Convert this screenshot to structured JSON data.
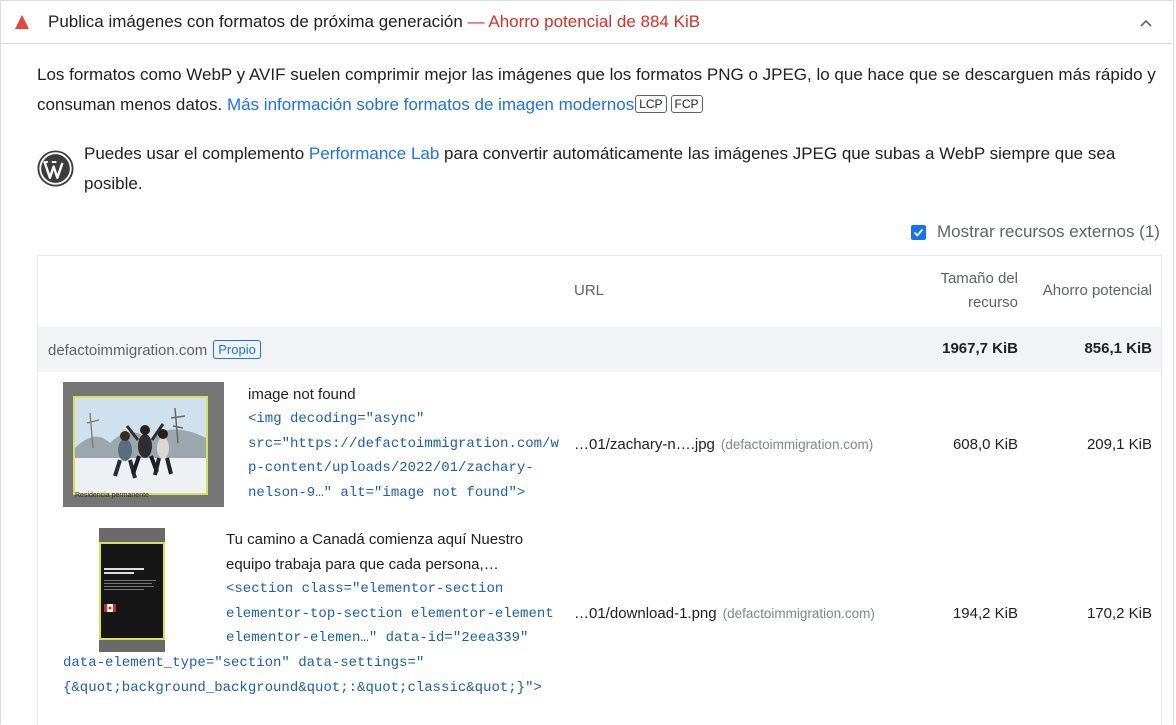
{
  "audit": {
    "title": "Publica imágenes con formatos de próxima generación",
    "savings_text": "— Ahorro potencial de 884 KiB"
  },
  "description": {
    "text": "Los formatos como WebP y AVIF suelen comprimir mejor las imágenes que los formatos PNG o JPEG, lo que hace que se descarguen más rápido y consuman menos datos. ",
    "link": "Más información sobre formatos de imagen modernos",
    "badges": [
      "LCP",
      "FCP"
    ]
  },
  "wordpress_hint": {
    "before": "Puedes usar el complemento ",
    "link": "Performance Lab",
    "after": " para convertir automáticamente las imágenes JPEG que subas a WebP siempre que sea posible."
  },
  "external_toggle": {
    "label": "Mostrar recursos externos (1)",
    "checked": true
  },
  "table": {
    "headers": {
      "url": "URL",
      "size": "Tamaño del recurso",
      "savings": "Ahorro potencial"
    },
    "group": {
      "name": "defactoimmigration.com",
      "badge": "Propio",
      "size": "1967,7 KiB",
      "savings": "856,1 KiB"
    },
    "rows": [
      {
        "node_label": "image not found",
        "snippet_lines": [
          "<img decoding=\"async\"",
          "src=\"https://defactoimmigration.com/w",
          "p-content/uploads/2022/01/zachary-",
          "nelson-9…\" alt=\"image not found\">"
        ],
        "thumb_caption": "Residencia permanente",
        "url": "…01/zachary-n….jpg",
        "host": "(defactoimmigration.com)",
        "size": "608,0 KiB",
        "savings": "209,1 KiB"
      },
      {
        "node_label_lines": [
          "Tu camino a Canadá comienza aquí Nuestro",
          "equipo trabaja para que cada persona,…"
        ],
        "snippet_lines": [
          "<section class=\"elementor-section",
          "elementor-top-section elementor-element",
          "elementor-elemen…\" data-id=\"2eea339\"",
          "data-element_type=\"section\" data-settings=\"",
          "{&quot;background_background&quot;:&quot;classic&quot;}\">"
        ],
        "url": "…01/download-1.png",
        "host": "(defactoimmigration.com)",
        "size": "194,2 KiB",
        "savings": "170,2 KiB"
      }
    ]
  },
  "colors": {
    "warning": "#d93025",
    "link": "#1a73e8",
    "code": "#1a5fb4",
    "group_bg": "#f1f3f4"
  }
}
